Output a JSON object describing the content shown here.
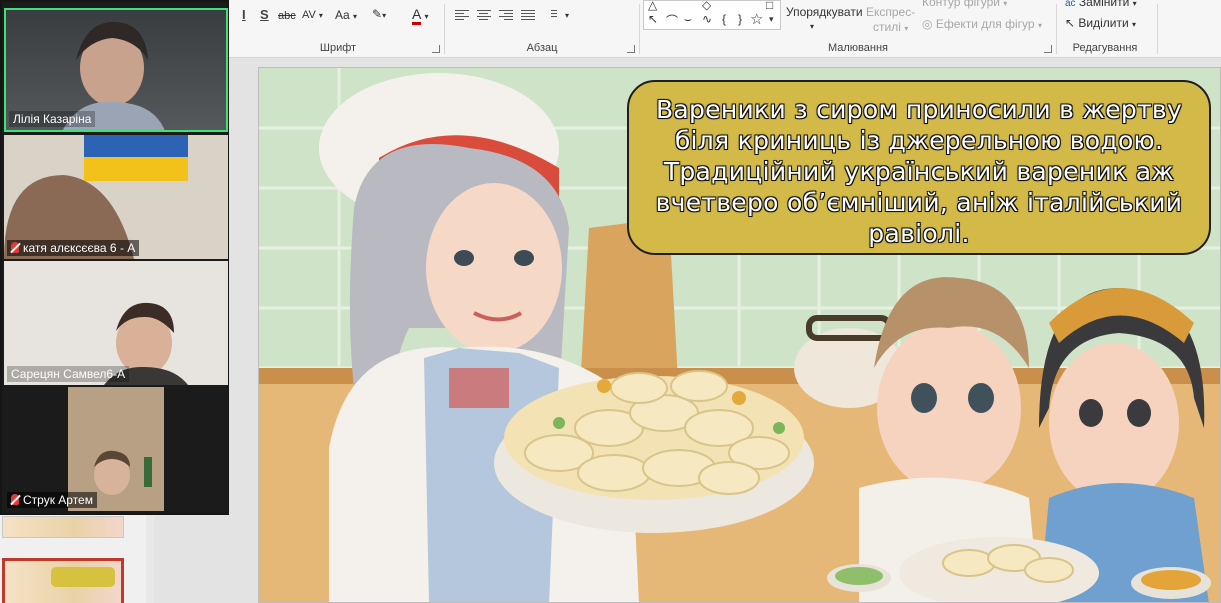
{
  "ribbon": {
    "groups": {
      "font": "Шрифт",
      "paragraph": "Абзац",
      "drawing": "Малювання",
      "editing": "Редагування"
    },
    "drawing": {
      "arrange": "Упорядкувати",
      "quick_styles_line1": "Експрес-",
      "quick_styles_line2": "стилі",
      "shape_outline": "Контур фігури",
      "shape_effects": "Ефекти для фігур"
    },
    "editing": {
      "replace": "Замінити",
      "select": "Виділити"
    },
    "font_tools": {
      "strikethrough": "abc",
      "char_spacing": "AV",
      "change_case": "Aa",
      "shadow": "S",
      "font_color": "A"
    }
  },
  "slide": {
    "caption": "Вареники з сиром приносили в жертву біля криниць із джерельною водою. Традиційний український вареник аж вчетверо об’ємніший, аніж італійський равіолі."
  },
  "video_call": {
    "participants": [
      {
        "name": "Лілія Казаріна",
        "muted": false,
        "speaking": true
      },
      {
        "name": "катя алєксєєва 6 - А",
        "muted": true,
        "speaking": false
      },
      {
        "name": "Сарецян Самвел6-А",
        "muted": false,
        "speaking": false
      },
      {
        "name": "Струк Артем",
        "muted": true,
        "speaking": false
      }
    ]
  },
  "colors": {
    "caption_box": "#d2b948",
    "speaking_border": "#3ee07a",
    "muted_mic": "#e53935",
    "active_thumb_border": "#c0392b"
  }
}
